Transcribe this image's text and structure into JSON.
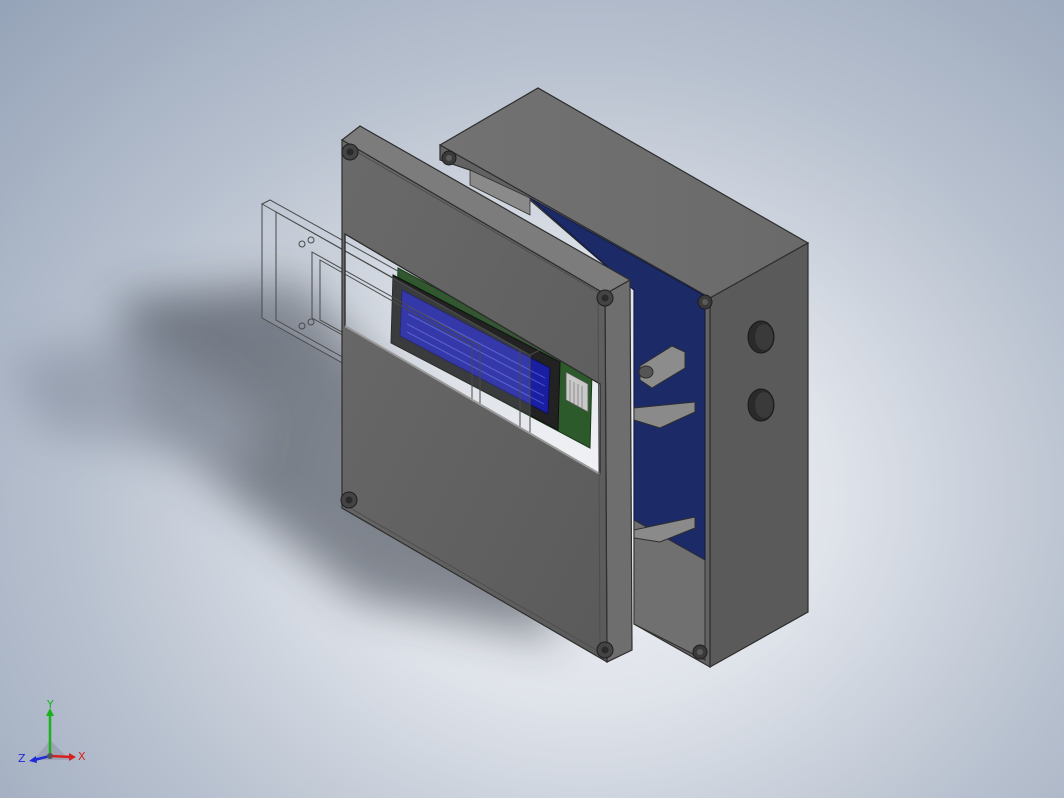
{
  "triad": {
    "x_label": "X",
    "y_label": "Y",
    "z_label": "Z",
    "x_color": "#d62020",
    "y_color": "#19b21e",
    "z_color": "#1f2bd6"
  },
  "colors": {
    "enclosure": "#5f5f5f",
    "enclosure_dark": "#4a4a4a",
    "enclosure_light": "#7a7a7a",
    "pcb": "#1c2a68",
    "lcd": "#1a1ea0",
    "lcd_frame": "#2a2a2a"
  },
  "icons": [
    "view-triad-icon"
  ]
}
